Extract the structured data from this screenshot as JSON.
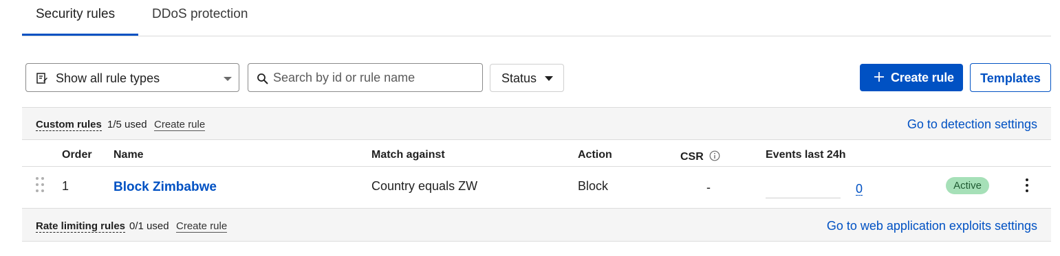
{
  "tabs": [
    {
      "label": "Security rules",
      "active": true
    },
    {
      "label": "DDoS protection",
      "active": false
    }
  ],
  "toolbar": {
    "rule_type_select": "Show all rule types",
    "search_placeholder": "Search by id or rule name",
    "search_value": "",
    "status_label": "Status",
    "create_label": "Create rule",
    "templates_label": "Templates"
  },
  "custom_section": {
    "title": "Custom rules",
    "used": "1/5 used",
    "create_link": "Create rule",
    "settings_link": "Go to detection settings"
  },
  "table": {
    "columns": [
      "Order",
      "Name",
      "Match against",
      "Action",
      "CSR",
      "Events last 24h"
    ],
    "rows": [
      {
        "order": "1",
        "name": "Block Zimbabwe",
        "match": "Country equals ZW",
        "action": "Block",
        "csr": "-",
        "events": "0",
        "status": "Active"
      }
    ]
  },
  "rate_section": {
    "title": "Rate limiting rules",
    "used": "0/1 used",
    "create_link": "Create rule",
    "settings_link": "Go to web application exploits settings"
  },
  "colors": {
    "accent": "#0051c3",
    "active_badge_bg": "#a6e0b8",
    "band_bg": "#f5f5f5"
  },
  "icons": [
    "rule-type-icon",
    "search-icon",
    "caret-down-icon",
    "plus-icon",
    "info-icon",
    "drag-handle-icon",
    "kebab-menu-icon"
  ]
}
